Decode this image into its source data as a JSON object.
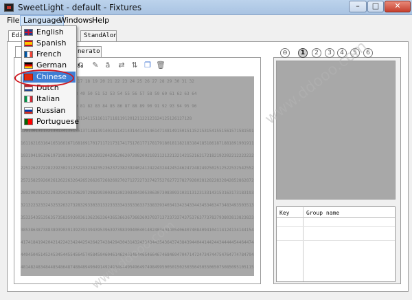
{
  "window": {
    "title": "SweetLight - default - Fixtures",
    "minimize": "–",
    "maximize": "□",
    "close": "✕"
  },
  "menubar": {
    "items": [
      "File",
      "Language",
      "Windows",
      "Help"
    ]
  },
  "outer_tabs": {
    "first_visible": "Edi",
    "standalone": "StandAlone"
  },
  "inner_tabs": {
    "left_partial": "",
    "generator_partial": "nerator"
  },
  "toolbar": {
    "icons": [
      "pencil-icon",
      "rename-icon",
      "swap-horizontal-icon",
      "swap-vertical-icon",
      "copy-icon",
      "trash-icon"
    ]
  },
  "grid_rows": [
    "9 10 11 12 13 14 15 16 17 18 19 20 21 22 23 24 25 26 27 28 29 30 31 32",
    "41 42 43 44 45 46 47 48 49 50 51 52 53 54 55 56 57 58 59 60 61 62 63 64",
    "73 74 75 76 77 78 79 80 81 82 83 84 85 86 87 88 89 90 91 92 93 94 95 96",
    "106107108109110111112113114115116117118119120121122123124125126127128",
    "129130131132133134135136137138139140141142143144145146147148149150151152153154155156157158159160",
    "161162163164165166167168169170171172173174175176177178179180181182183184185186187188189190191192",
    "193194195196197198199200201202203204205206207208209210211212213214215216217218219220221222223224",
    "225226227228229230231232233234235236237238239240241242243244245246247248249250251252253254255256",
    "257258259260261262263264265266267268269270271272273274275276277278279280281282283284285286287288",
    "289290291292293294295296297298299300301302303304305306307308309310311312313314315316317318319320",
    "321322323324325326327328329330331332333334335336337338339340341342343344345346347348349350351352",
    "353354355356357358359360361362363364365366367368369370371372373374375376377378379380381382383384",
    "385386387388389390391392393394395396397398399400401402403404405406407408409410411412413414415416",
    "417418419420421422423424425426427428429430431432433434435436437438439440441442443444445446447448",
    "449450451452453454455456457458459460461462463464465466467468469470471472473474475476477478479480",
    "481482483484485486487488489490491492493494495496497498499500501502503504505506507508509510511512"
  ],
  "right_panel": {
    "buttons": [
      "⊖",
      "1",
      "2",
      "3",
      "4",
      "5",
      "6"
    ],
    "table_headers": [
      "Key",
      "Group name"
    ]
  },
  "language_menu": {
    "items": [
      {
        "label": "English",
        "flag": "uk-flag-icon"
      },
      {
        "label": "Spanish",
        "flag": "spain-flag-icon"
      },
      {
        "label": "French",
        "flag": "france-flag-icon"
      },
      {
        "label": "German",
        "flag": "germany-flag-icon"
      },
      {
        "label": "Chinese",
        "flag": "china-flag-icon"
      },
      {
        "label": "Dutch",
        "flag": "netherlands-flag-icon"
      },
      {
        "label": "Italian",
        "flag": "italy-flag-icon"
      },
      {
        "label": "Russian",
        "flag": "russia-flag-icon"
      },
      {
        "label": "Portuguese",
        "flag": "portugal-flag-icon"
      }
    ],
    "highlighted_index": 4
  },
  "watermark": {
    "text": "www.ddooo.com"
  },
  "colors": {
    "highlight": "#3f7fd4",
    "ring": "#d0181f",
    "grid_bg": "#a8a8a8"
  }
}
